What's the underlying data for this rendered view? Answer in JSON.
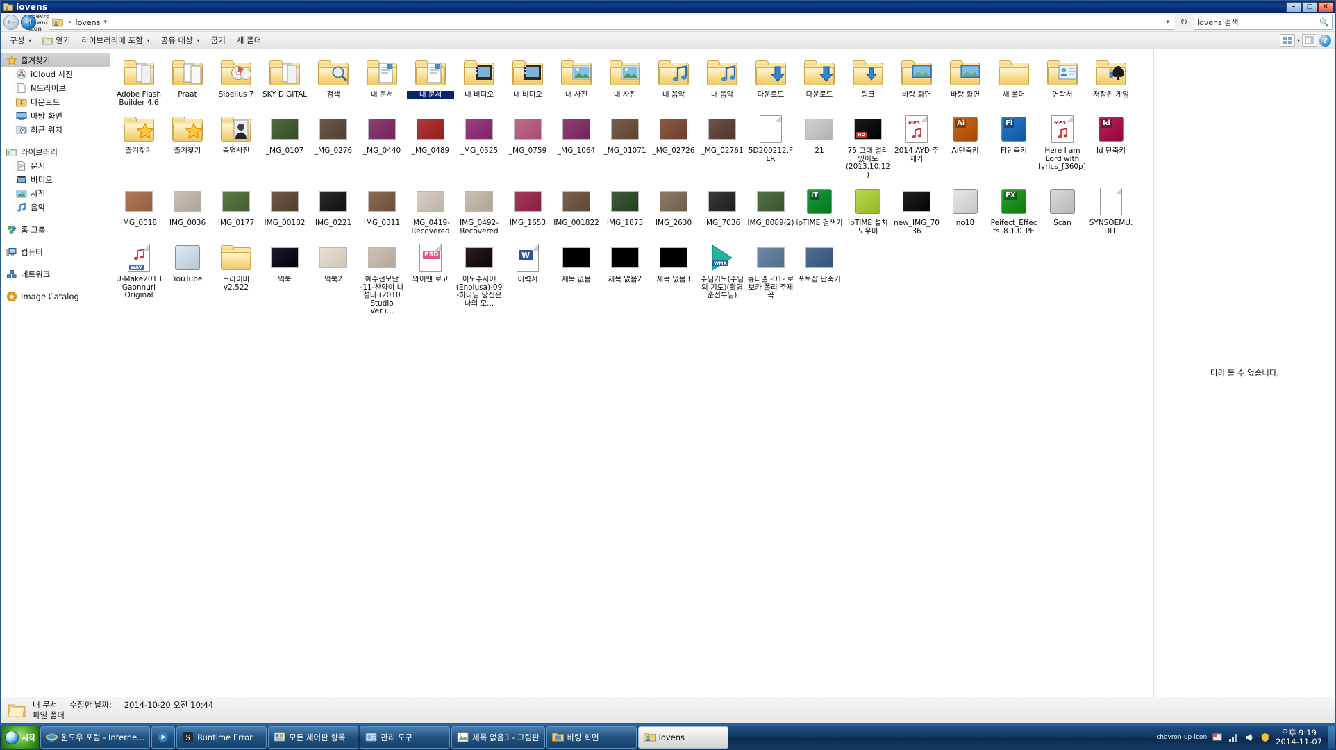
{
  "window": {
    "title": "lovens",
    "icon": "folder-user-icon",
    "buttons": {
      "minimize": "–",
      "maximize": "□",
      "close": "✕"
    }
  },
  "address": {
    "back_icon": "back-arrow-icon",
    "forward_icon": "forward-arrow-icon",
    "history_icon": "chevron-down-icon",
    "folder_icon": "folder-user-icon",
    "separator": "▸",
    "crumb": "lovens",
    "crumb_caret": "▾",
    "dropdown_caret": "▾",
    "refresh_icon": "refresh-icon",
    "search_value": "lovens 검색",
    "search_icon": "search-icon"
  },
  "commandbar": {
    "items": [
      {
        "label": "구성",
        "caret": "▾",
        "icon": ""
      },
      {
        "label": "열기",
        "caret": "",
        "icon": "open-folder-icon"
      },
      {
        "label": "라이브러리에 포함",
        "caret": "▾",
        "icon": ""
      },
      {
        "label": "공유 대상",
        "caret": "▾",
        "icon": ""
      },
      {
        "label": "굽기",
        "caret": "",
        "icon": ""
      },
      {
        "label": "새 폴더",
        "caret": "",
        "icon": ""
      }
    ],
    "view_icon": "view-layout-icon",
    "view_caret": "▾",
    "pane_icon": "preview-pane-icon",
    "help_icon": "help-icon",
    "help_glyph": "?"
  },
  "navpane": {
    "groups": [
      {
        "root": {
          "label": "즐겨찾기",
          "icon": "star-icon",
          "selected": true
        },
        "children": [
          {
            "label": "iCloud 사진",
            "icon": "icloud-photos-icon"
          },
          {
            "label": "N드라이브",
            "icon": "document-icon"
          },
          {
            "label": "다운로드",
            "icon": "downloads-folder-icon"
          },
          {
            "label": "바탕 화면",
            "icon": "desktop-icon"
          },
          {
            "label": "최근 위치",
            "icon": "recent-places-icon"
          }
        ]
      },
      {
        "root": {
          "label": "라이브러리",
          "icon": "library-icon",
          "selected": false
        },
        "children": [
          {
            "label": "문서",
            "icon": "documents-library-icon"
          },
          {
            "label": "비디오",
            "icon": "videos-library-icon"
          },
          {
            "label": "사진",
            "icon": "pictures-library-icon"
          },
          {
            "label": "음악",
            "icon": "music-library-icon"
          }
        ]
      },
      {
        "root": {
          "label": "홈 그룹",
          "icon": "homegroup-icon",
          "selected": false
        },
        "children": []
      },
      {
        "root": {
          "label": "컴퓨터",
          "icon": "computer-icon",
          "selected": false
        },
        "children": []
      },
      {
        "root": {
          "label": "네트워크",
          "icon": "network-icon",
          "selected": false
        },
        "children": []
      },
      {
        "root": {
          "label": "Image Catalog",
          "icon": "image-catalog-icon",
          "selected": false
        },
        "children": []
      }
    ]
  },
  "files": [
    {
      "name": "Adobe Flash Builder 4.6",
      "type": "folder",
      "overlay": "files",
      "selected": false
    },
    {
      "name": "Praat",
      "type": "folder",
      "overlay": "files2",
      "selected": false
    },
    {
      "name": "Sibelius 7",
      "type": "folder",
      "overlay": "disc",
      "selected": false
    },
    {
      "name": "SKY DIGITAL",
      "type": "folder",
      "overlay": "files",
      "selected": false
    },
    {
      "name": "검색",
      "type": "folder",
      "overlay": "search",
      "selected": false
    },
    {
      "name": "내 문서",
      "type": "folder",
      "overlay": "doc",
      "selected": false
    },
    {
      "name": "내 문서",
      "type": "folder",
      "overlay": "doc",
      "selected": true
    },
    {
      "name": "내 비디오",
      "type": "folder",
      "overlay": "video",
      "selected": false
    },
    {
      "name": "내 비디오",
      "type": "folder",
      "overlay": "video",
      "selected": false
    },
    {
      "name": "내 사진",
      "type": "folder",
      "overlay": "pic",
      "selected": false
    },
    {
      "name": "내 사진",
      "type": "folder",
      "overlay": "pic",
      "selected": false
    },
    {
      "name": "내 음악",
      "type": "folder",
      "overlay": "music",
      "selected": false
    },
    {
      "name": "내 음악",
      "type": "folder",
      "overlay": "music",
      "selected": false
    },
    {
      "name": "다운로드",
      "type": "folder",
      "overlay": "down",
      "selected": false
    },
    {
      "name": "다운로드",
      "type": "folder",
      "overlay": "down",
      "selected": false
    },
    {
      "name": "링크",
      "type": "folder",
      "overlay": "link",
      "selected": false
    },
    {
      "name": "바탕 화면",
      "type": "folder",
      "overlay": "desktop",
      "selected": false
    },
    {
      "name": "바탕 화면",
      "type": "folder",
      "overlay": "desktop",
      "selected": false
    },
    {
      "name": "새 폴더",
      "type": "folder",
      "overlay": "",
      "selected": false
    },
    {
      "name": "연락처",
      "type": "folder",
      "overlay": "contacts",
      "selected": false
    },
    {
      "name": "저장된 게임",
      "type": "folder",
      "overlay": "games",
      "selected": false
    },
    {
      "name": "즐겨찾기",
      "type": "folder",
      "overlay": "star",
      "selected": false
    },
    {
      "name": "즐겨찾기",
      "type": "folder",
      "overlay": "star",
      "selected": false
    },
    {
      "name": "증명사진",
      "type": "folder",
      "overlay": "portrait",
      "selected": false
    },
    {
      "name": "_MG_0107",
      "type": "photo",
      "tint": "#4d6b3f",
      "selected": false
    },
    {
      "name": "_MG_0276",
      "type": "photo",
      "tint": "#6e5a4c",
      "selected": false
    },
    {
      "name": "_MG_0440",
      "type": "photo",
      "tint": "#8e3f76",
      "selected": false
    },
    {
      "name": "_MG_0489",
      "type": "photo",
      "tint": "#b03a3a",
      "selected": false
    },
    {
      "name": "_MG_0525",
      "type": "photo",
      "tint": "#9b3f85",
      "selected": false
    },
    {
      "name": "_MG_0759",
      "type": "photo",
      "tint": "#c06a8e",
      "selected": false
    },
    {
      "name": "_MG_1064",
      "type": "photo",
      "tint": "#8e3f76",
      "selected": false
    },
    {
      "name": "_MG_01071",
      "type": "photo",
      "tint": "#7a5f4a",
      "selected": false
    },
    {
      "name": "_MG_02726",
      "type": "photo",
      "tint": "#8a5a49",
      "selected": false
    },
    {
      "name": "_MG_02761",
      "type": "photo",
      "tint": "#6d5246",
      "selected": false
    },
    {
      "name": "5D200212.FLR",
      "type": "file",
      "overlay": "",
      "selected": false
    },
    {
      "name": "21",
      "type": "photo",
      "tint": "#cfcfcf",
      "selected": false
    },
    {
      "name": "75 그대 멀리 있어도 (2013.10.12)",
      "type": "photo",
      "tint": "#1a1a1a",
      "badge": "HD",
      "selected": false
    },
    {
      "name": "2014 AYD 주 제가",
      "type": "mp3",
      "badge": "MP3",
      "selected": false
    },
    {
      "name": "Ai단축키",
      "type": "app",
      "tint": "#c96a1e",
      "badge": "Ai",
      "selected": false
    },
    {
      "name": "Fl단축키",
      "type": "app",
      "tint": "#2e7ac9",
      "badge": "Fl",
      "selected": false
    },
    {
      "name": "Here I am Lord with lyrics_[360p]",
      "type": "mp3",
      "badge": "MP3",
      "selected": false
    },
    {
      "name": "Id 단축키",
      "type": "app",
      "tint": "#b8255f",
      "badge": "Id",
      "selected": false
    },
    {
      "name": "IMG_0018",
      "type": "photo",
      "tint": "#b07a5a",
      "selected": false
    },
    {
      "name": "IMG_0036",
      "type": "photo",
      "tint": "#c8c0b4",
      "selected": false
    },
    {
      "name": "IMG_0177",
      "type": "photo",
      "tint": "#5f7a4a",
      "selected": false
    },
    {
      "name": "IMG_00182",
      "type": "photo",
      "tint": "#6f5a48",
      "selected": false
    },
    {
      "name": "IMG_0221",
      "type": "photo",
      "tint": "#2b2b2b",
      "selected": false
    },
    {
      "name": "IMG_0311",
      "type": "photo",
      "tint": "#8a6a55",
      "selected": false
    },
    {
      "name": "IMG_0419-Recovered",
      "type": "photo",
      "tint": "#d8cfc4",
      "selected": false
    },
    {
      "name": "IMG_0492-Recovered",
      "type": "photo",
      "tint": "#cbbfb2",
      "selected": false
    },
    {
      "name": "IMG_1653",
      "type": "photo",
      "tint": "#a33a5a",
      "selected": false
    },
    {
      "name": "IMG_001822",
      "type": "photo",
      "tint": "#7a6450",
      "selected": false
    },
    {
      "name": "IMG_1873",
      "type": "photo",
      "tint": "#3f5a3a",
      "selected": false
    },
    {
      "name": "IMG_2630",
      "type": "photo",
      "tint": "#8b7a66",
      "selected": false
    },
    {
      "name": "IMG_7036",
      "type": "photo",
      "tint": "#3a3a3a",
      "selected": false
    },
    {
      "name": "IMG_8089(2)",
      "type": "photo",
      "tint": "#55704a",
      "selected": false
    },
    {
      "name": "ipTIME 검색기",
      "type": "app",
      "tint": "#1f9a3f",
      "badge": "iT",
      "selected": false
    },
    {
      "name": "ipTIME 설치 도우미",
      "type": "app",
      "tint": "#b7d94a",
      "badge": "",
      "selected": false
    },
    {
      "name": "new_IMG_7036",
      "type": "photo",
      "tint": "#1f1f1f",
      "selected": false
    },
    {
      "name": "no18",
      "type": "app",
      "tint": "#e8e8e8",
      "badge": "",
      "selected": false
    },
    {
      "name": "Peifect_Effects_8.1.0_PE",
      "type": "app",
      "tint": "#2f9e2f",
      "badge": "FX",
      "selected": false
    },
    {
      "name": "Scan",
      "type": "app",
      "tint": "#dadada",
      "badge": "",
      "selected": false
    },
    {
      "name": "SYNSOEMU.DLL",
      "type": "file",
      "overlay": "dll",
      "selected": false
    },
    {
      "name": "U-Make2013 Gaonnuri Original",
      "type": "wav",
      "badge": "WAV",
      "selected": false
    },
    {
      "name": "YouTube",
      "type": "app",
      "tint": "#dbeaf7",
      "badge": "",
      "selected": false
    },
    {
      "name": "드라이버 v2.522",
      "type": "folder",
      "overlay": "",
      "selected": false
    },
    {
      "name": "먹북",
      "type": "photo",
      "tint": "#1b1b2b",
      "selected": false
    },
    {
      "name": "먹북2",
      "type": "photo",
      "tint": "#e9e2d4",
      "selected": false
    },
    {
      "name": "예수전모단 -11-찬양이 나섬다 (2010 Studio Ver.)...",
      "type": "photo",
      "tint": "#cfc2b4",
      "selected": false
    },
    {
      "name": "와이맨 로고",
      "type": "psd",
      "badge": "PSD",
      "selected": false
    },
    {
      "name": "이노주사야(Enoiusa)-09-하나님 당신은 나의 모...",
      "type": "photo",
      "tint": "#2a2020",
      "selected": false
    },
    {
      "name": "이력서",
      "type": "doc",
      "badge": "W",
      "selected": false
    },
    {
      "name": "제목 없음",
      "type": "photo",
      "tint": "#000000",
      "selected": false
    },
    {
      "name": "제목 없음2",
      "type": "photo",
      "tint": "#000000",
      "selected": false
    },
    {
      "name": "제목 없음3",
      "type": "photo",
      "tint": "#000000",
      "selected": false
    },
    {
      "name": "주님기도(주님의 기도)(촬영준선부님)",
      "type": "wma",
      "badge": "WMA",
      "selected": false
    },
    {
      "name": "큐티엘 -01- 로보카 폴리 주제곡",
      "type": "photo",
      "tint": "#6e8aa8",
      "selected": false
    },
    {
      "name": "포토샵 단축키",
      "type": "photo",
      "tint": "#4f6f93",
      "selected": false
    }
  ],
  "preview": {
    "message": "미리 볼 수 없습니다."
  },
  "details": {
    "icon": "folder-icon",
    "name": "내 문서",
    "modified_label": "수정한 날짜:",
    "modified_value": "2014-10-20 오전 10:44",
    "kind": "파일 폴더"
  },
  "taskbar": {
    "start_label": "시작",
    "start_icon": "windows-orb-icon",
    "items": [
      {
        "label": "윈도우 포럼 - Interne...",
        "icon": "internet-explorer-icon",
        "active": false
      },
      {
        "label": "",
        "icon": "media-player-icon",
        "active": false
      },
      {
        "label": "Runtime Error",
        "icon": "app-error-icon",
        "active": false
      },
      {
        "label": "모든 제어판 항목",
        "icon": "control-panel-icon",
        "active": false
      },
      {
        "label": "관리 도구",
        "icon": "admin-tools-icon",
        "active": false
      },
      {
        "label": "제목 없음3 - 그림판",
        "icon": "paint-icon",
        "active": false
      },
      {
        "label": "바탕 화면",
        "icon": "desktop-folder-icon",
        "active": false
      },
      {
        "label": "lovens",
        "icon": "folder-user-icon",
        "active": true
      }
    ],
    "tray": {
      "expand_icon": "chevron-up-icon",
      "icons": [
        "flag-icon",
        "network-icon",
        "volume-icon",
        "shield-icon"
      ],
      "time": "오후 9:19",
      "date": "2014-11-07",
      "show_desktop": "show-desktop-button"
    }
  }
}
